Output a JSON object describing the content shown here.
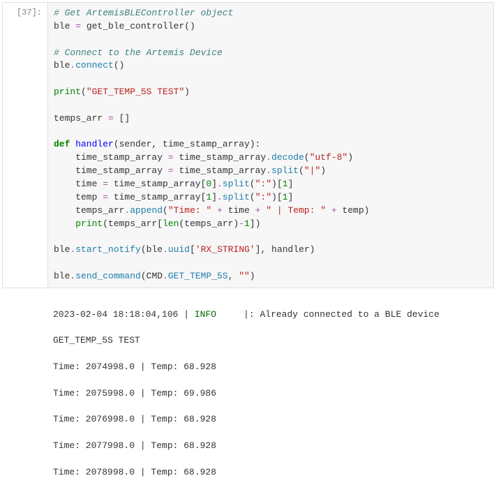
{
  "prompt": "[37]:",
  "code": {
    "l1": "# Get ArtemisBLEController object",
    "l2_a": "ble ",
    "l2_b": " get_ble_controller()",
    "l3": "# Connect to the Artemis Device",
    "l4_a": "ble",
    "l4_b": "connect",
    "l4_c": "()",
    "l5_a": "print",
    "l5_b": "(",
    "l5_c": "\"GET_TEMP_5S TEST\"",
    "l5_d": ")",
    "l6_a": "temps_arr ",
    "l6_op": "=",
    "l6_b": " []",
    "l7_def": "def",
    "l7_name": " handler",
    "l7_rest": "(sender, time_stamp_array):",
    "l8_a": "    time_stamp_array ",
    "l8_op": "=",
    "l8_b": " time_stamp_array",
    "l8_dot": ".",
    "l8_m": "decode",
    "l8_p1": "(",
    "l8_s": "\"utf-8\"",
    "l8_p2": ")",
    "l9_a": "    time_stamp_array ",
    "l9_op": "=",
    "l9_b": " time_stamp_array",
    "l9_dot": ".",
    "l9_m": "split",
    "l9_p1": "(",
    "l9_s": "\"|\"",
    "l9_p2": ")",
    "l10_a": "    time ",
    "l10_op": "=",
    "l10_b": " time_stamp_array[",
    "l10_n0": "0",
    "l10_c": "]",
    "l10_dot": ".",
    "l10_m": "split",
    "l10_p1": "(",
    "l10_s": "\":\"",
    "l10_p2": ")[",
    "l10_n1": "1",
    "l10_p3": "]",
    "l11_a": "    temp ",
    "l11_op": "=",
    "l11_b": " time_stamp_array[",
    "l11_n1": "1",
    "l11_c": "]",
    "l11_dot": ".",
    "l11_m": "split",
    "l11_p1": "(",
    "l11_s": "\":\"",
    "l11_p2": ")[",
    "l11_n1b": "1",
    "l11_p3": "]",
    "l12_a": "    temps_arr",
    "l12_dot": ".",
    "l12_m": "append",
    "l12_p1": "(",
    "l12_s1": "\"Time: \"",
    "l12_op1": " + ",
    "l12_b": "time",
    "l12_op2": " + ",
    "l12_s2": "\" | Temp: \"",
    "l12_op3": " + ",
    "l12_c": "temp)",
    "l13_a": "    ",
    "l13_print": "print",
    "l13_b": "(temps_arr[",
    "l13_len": "len",
    "l13_c": "(temps_arr)",
    "l13_op": "-",
    "l13_n": "1",
    "l13_d": "])",
    "l14_a": "ble",
    "l14_dot": ".",
    "l14_m": "start_notify",
    "l14_p1": "(ble",
    "l14_dot2": ".",
    "l14_u": "uuid",
    "l14_b1": "[",
    "l14_s": "'RX_STRING'",
    "l14_b2": "], handler)",
    "l15_a": "ble",
    "l15_dot": ".",
    "l15_m": "send_command",
    "l15_p1": "(CMD",
    "l15_dot2": ".",
    "l15_g": "GET_TEMP_5S",
    "l15_c": ", ",
    "l15_s": "\"\"",
    "l15_p2": ")"
  },
  "output": {
    "line1_a": "2023-02-04 18:18:04,106 | ",
    "line1_level": "INFO",
    "line1_b": "     |: Already connected to a BLE device",
    "line2": "GET_TEMP_5S TEST",
    "lines": [
      "Time: 2074998.0 | Temp: 68.928",
      "Time: 2075998.0 | Temp: 69.986",
      "Time: 2076998.0 | Temp: 68.928",
      "Time: 2077998.0 | Temp: 68.928",
      "Time: 2078998.0 | Temp: 68.928"
    ]
  }
}
